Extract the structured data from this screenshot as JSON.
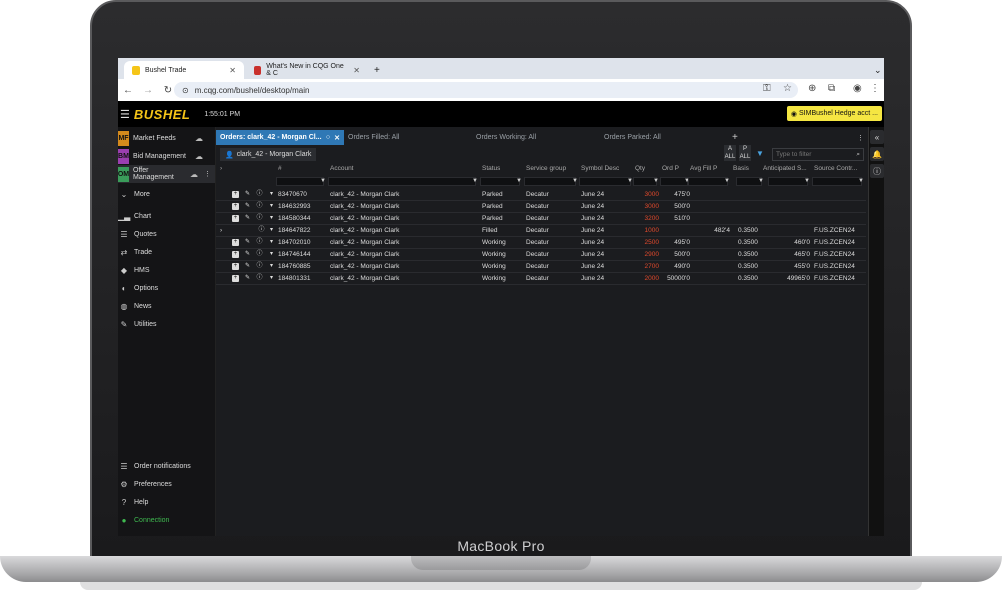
{
  "device": {
    "label": "MacBook Pro"
  },
  "browser": {
    "tabs": [
      {
        "title": "Bushel Trade",
        "favicon_color": "#f5c518"
      },
      {
        "title": "What's New in CQG One & C",
        "favicon_color": "#c9302c"
      }
    ],
    "new_tab": "+",
    "url": "m.cqg.com/bushel/desktop/main",
    "expand_menu": "⌄"
  },
  "app": {
    "logo": "BUSHEL",
    "time": "1:55:01 PM",
    "account_button": "SIMBushel Hedge acct ..."
  },
  "sidebar": {
    "top_items": [
      {
        "badge": "MF",
        "badge_color": "#d48a1c",
        "label": "Market Feeds",
        "status": "cloud"
      },
      {
        "badge": "BM",
        "badge_color": "#9b3fb0",
        "label": "Bid Management",
        "status": "cloud"
      },
      {
        "badge": "OM",
        "badge_color": "#3a9c5a",
        "label": "Offer Management",
        "status": "cloud",
        "extra": "⋮"
      }
    ],
    "more": "More",
    "nav_items": [
      {
        "icon": "chart-icon",
        "glyph": "▁▃",
        "label": "Chart"
      },
      {
        "icon": "quotes-icon",
        "glyph": "☰",
        "label": "Quotes"
      },
      {
        "icon": "trade-icon",
        "glyph": "⇄",
        "label": "Trade"
      },
      {
        "icon": "hms-icon",
        "glyph": "◆",
        "label": "HMS"
      },
      {
        "icon": "options-icon",
        "glyph": "◐",
        "label": "Options"
      },
      {
        "icon": "news-icon",
        "glyph": "◍",
        "label": "News"
      },
      {
        "icon": "utilities-icon",
        "glyph": "✎",
        "label": "Utilities"
      }
    ],
    "bottom_items": [
      {
        "icon": "notifications-icon",
        "glyph": "☰",
        "label": "Order notifications"
      },
      {
        "icon": "preferences-icon",
        "glyph": "⚙",
        "label": "Preferences"
      },
      {
        "icon": "help-icon",
        "glyph": "?",
        "label": "Help"
      },
      {
        "icon": "connection-icon",
        "glyph": "●",
        "label": "Connection",
        "color": "#3fb950"
      }
    ]
  },
  "widget_tabs": [
    {
      "label": "Orders: clark_42 - Morgan Cl...",
      "active": true
    },
    {
      "label": "Orders Filled: All"
    },
    {
      "label": "Orders Working: All"
    },
    {
      "label": "Orders Parked: All"
    }
  ],
  "add_tab": "+",
  "filter_chip": "clark_42 - Morgan Clark",
  "filter_placeholder": "Type to filter",
  "toggles": [
    {
      "letter": "A",
      "sub": "ALL"
    },
    {
      "letter": "P",
      "sub": "ALL"
    }
  ],
  "columns": [
    "#",
    "Account",
    "Status",
    "Service group",
    "Symbol Desc",
    "Qty",
    "Ord P",
    "Avg Fill P",
    "Basis",
    "Anticipated S...",
    "Source Contr..."
  ],
  "rows": [
    {
      "id": "83470670",
      "account": "clark_42 - Morgan Clark",
      "status": "Parked",
      "group": "Decatur",
      "symbol": "June 24",
      "qty": "3000",
      "ordp": "475'0",
      "avgfill": "",
      "basis": "",
      "antic": "",
      "source": ""
    },
    {
      "id": "184632993",
      "account": "clark_42 - Morgan Clark",
      "status": "Parked",
      "group": "Decatur",
      "symbol": "June 24",
      "qty": "3000",
      "ordp": "500'0",
      "avgfill": "",
      "basis": "",
      "antic": "",
      "source": ""
    },
    {
      "id": "184580344",
      "account": "clark_42 - Morgan Clark",
      "status": "Parked",
      "group": "Decatur",
      "symbol": "June 24",
      "qty": "3200",
      "ordp": "510'0",
      "avgfill": "",
      "basis": "",
      "antic": "",
      "source": ""
    },
    {
      "id": "184647822",
      "account": "clark_42 - Morgan Clark",
      "status": "Filled",
      "group": "Decatur",
      "symbol": "June 24",
      "qty": "1000",
      "ordp": "",
      "avgfill": "482'4",
      "basis": "0.3500",
      "antic": "",
      "source": "F.US.ZCEN24",
      "expandable": true
    },
    {
      "id": "184702010",
      "account": "clark_42 - Morgan Clark",
      "status": "Working",
      "group": "Decatur",
      "symbol": "June 24",
      "qty": "2500",
      "ordp": "495'0",
      "avgfill": "",
      "basis": "0.3500",
      "antic": "460'0",
      "source": "F.US.ZCEN24"
    },
    {
      "id": "184746144",
      "account": "clark_42 - Morgan Clark",
      "status": "Working",
      "group": "Decatur",
      "symbol": "June 24",
      "qty": "2900",
      "ordp": "500'0",
      "avgfill": "",
      "basis": "0.3500",
      "antic": "465'0",
      "source": "F.US.ZCEN24"
    },
    {
      "id": "184760885",
      "account": "clark_42 - Morgan Clark",
      "status": "Working",
      "group": "Decatur",
      "symbol": "June 24",
      "qty": "2700",
      "ordp": "490'0",
      "avgfill": "",
      "basis": "0.3500",
      "antic": "455'0",
      "source": "F.US.ZCEN24"
    },
    {
      "id": "184801331",
      "account": "clark_42 - Morgan Clark",
      "status": "Working",
      "group": "Decatur",
      "symbol": "June 24",
      "qty": "2000",
      "ordp": "50000'0",
      "avgfill": "",
      "basis": "0.3500",
      "antic": "49965'0",
      "source": "F.US.ZCEN24"
    }
  ]
}
